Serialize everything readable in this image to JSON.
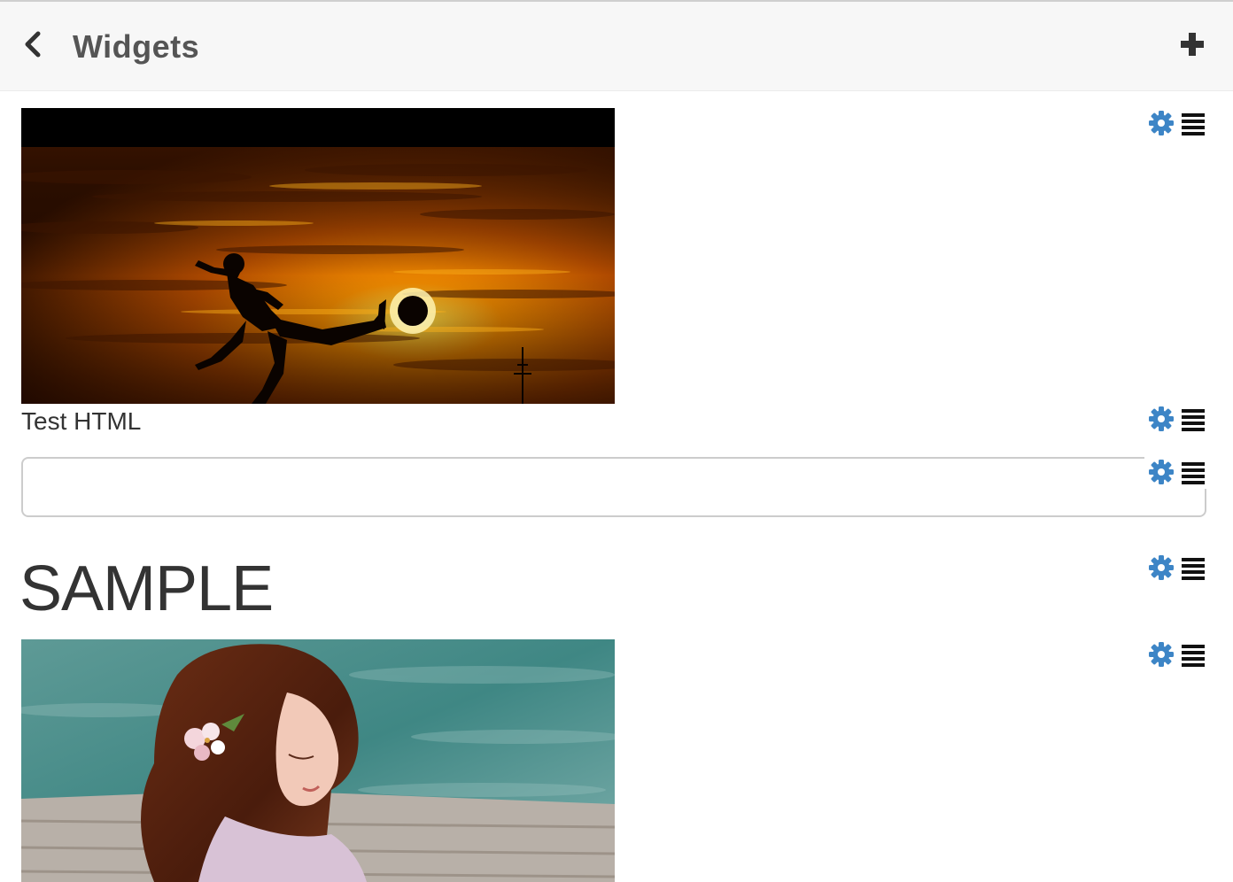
{
  "header": {
    "title": "Widgets",
    "back_icon": "chevron-left-icon",
    "add_icon": "plus-icon"
  },
  "widgets": [
    {
      "type": "image",
      "subject": "silhouette kicking ball at sunset"
    },
    {
      "type": "html",
      "text": "Test HTML"
    },
    {
      "type": "text-input",
      "value": "",
      "placeholder": ""
    },
    {
      "type": "heading",
      "text": "SAMPLE"
    },
    {
      "type": "image",
      "subject": "woman with flower in hair by water"
    }
  ],
  "controls": {
    "settings_icon": "gear-icon",
    "menu_icon": "list-icon"
  },
  "colors": {
    "accent": "#3d85c6",
    "header_bg": "#f7f7f7",
    "title": "#555555",
    "text": "#333333"
  }
}
